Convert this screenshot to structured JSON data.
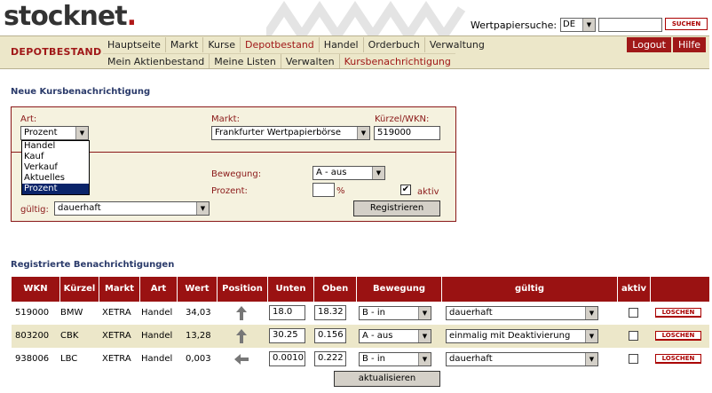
{
  "header": {
    "logo_text": "stocknet",
    "logo_dot": ".",
    "search_label": "Wertpapiersuche:",
    "search_country": "DE",
    "search_input_value": "",
    "search_button": "SUCHEN"
  },
  "nav": {
    "section": "DEPOTBESTAND",
    "row1": [
      "Hauptseite",
      "Markt",
      "Kurse",
      "Depotbestand",
      "Handel",
      "Orderbuch",
      "Verwaltung"
    ],
    "row1_active": "Depotbestand",
    "row2": [
      "Mein Aktienbestand",
      "Meine Listen",
      "Verwalten",
      "Kursbenachrichtigung"
    ],
    "row2_active": "Kursbenachrichtigung",
    "logout": "Logout",
    "help": "Hilfe"
  },
  "form": {
    "title": "Neue Kursbenachrichtigung",
    "art_label": "Art:",
    "art_value": "Prozent",
    "art_options": [
      "Handel",
      "Kauf",
      "Verkauf",
      "Aktuelles",
      "Prozent"
    ],
    "art_selected": "Prozent",
    "markt_label": "Markt:",
    "markt_value": "Frankfurter Wertpapierbörse",
    "wkn_label": "Kürzel/WKN:",
    "wkn_value": "519000",
    "bewegung_label": "Bewegung:",
    "bewegung_value": "A - aus",
    "prozent_label": "Prozent:",
    "prozent_value": "",
    "percent_sign": "%",
    "aktiv_label": "aktiv",
    "aktiv_checked": "✔",
    "gueltig_label": "gültig:",
    "gueltig_value": "dauerhaft",
    "submit": "Registrieren"
  },
  "table": {
    "title": "Registrierte Benachrichtigungen",
    "columns": [
      "WKN",
      "Kürzel",
      "Markt",
      "Art",
      "Wert",
      "Position",
      "Unten",
      "Oben",
      "Bewegung",
      "gültig",
      "aktiv"
    ],
    "rows": [
      {
        "wkn": "519000",
        "kuerzel": "BMW",
        "markt": "XETRA",
        "art": "Handel",
        "wert": "34,03",
        "position": "up-arrow-icon",
        "unten": "18.0",
        "oben": "18.32",
        "bewegung": "B - in",
        "gueltig": "dauerhaft",
        "delete": "LÖSCHEN"
      },
      {
        "wkn": "803200",
        "kuerzel": "CBK",
        "markt": "XETRA",
        "art": "Handel",
        "wert": "13,28",
        "position": "up-arrow-icon",
        "unten": "30.25",
        "oben": "0.156",
        "bewegung": "A - aus",
        "gueltig": "einmalig mit Deaktivierung",
        "delete": "LÖSCHEN"
      },
      {
        "wkn": "938006",
        "kuerzel": "LBC",
        "markt": "XETRA",
        "art": "Handel",
        "wert": "0,003",
        "position": "left-arrow-icon",
        "unten": "0.0010",
        "oben": "0.222",
        "bewegung": "B - in",
        "gueltig": "dauerhaft",
        "delete": "LÖSCHEN"
      }
    ],
    "refresh": "aktualisieren"
  },
  "colors": {
    "brand_red": "#a01818",
    "nav_bg": "#ece7c9",
    "table_header": "#9a1212",
    "title_blue": "#2a3a6a"
  }
}
